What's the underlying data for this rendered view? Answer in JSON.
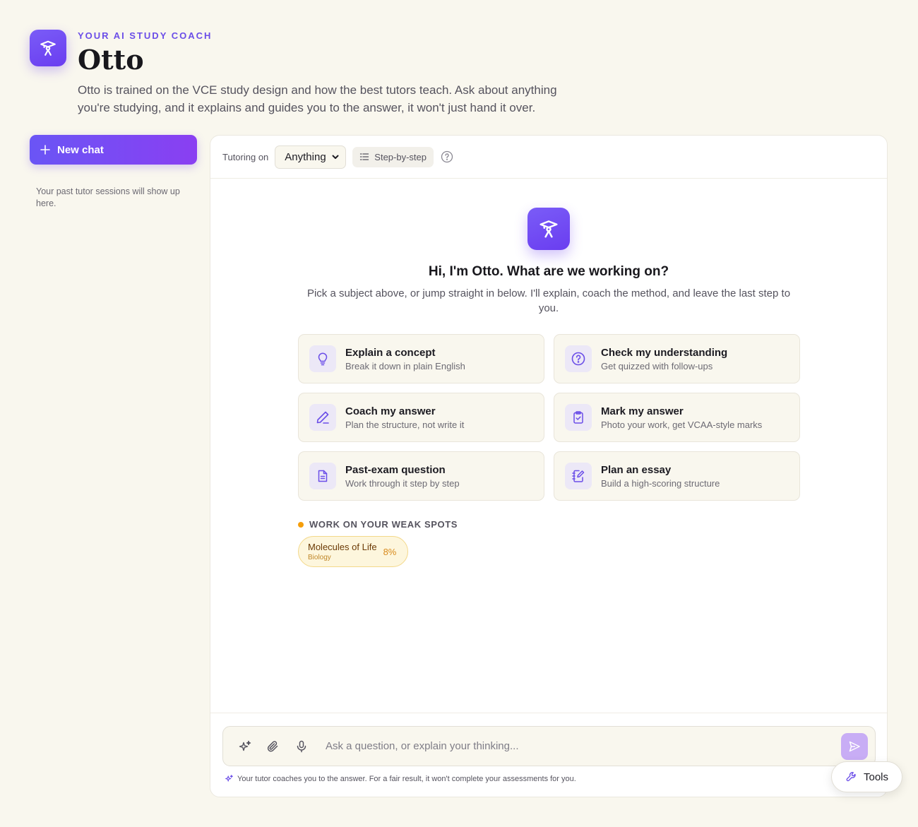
{
  "header": {
    "eyebrow": "YOUR AI STUDY COACH",
    "title": "Otto",
    "description": "Otto is trained on the VCE study design and how the best tutors teach. Ask about anything you're studying, and it explains and guides you to the answer, it won't just hand it over."
  },
  "sidebar": {
    "new_chat_label": "New chat",
    "empty_text": "Your past tutor sessions will show up here."
  },
  "toolbar": {
    "tutoring_label": "Tutoring on",
    "subject_selected": "Anything",
    "mode_label": "Step-by-step"
  },
  "welcome": {
    "title": "Hi, I'm Otto. What are we working on?",
    "subtitle": "Pick a subject above, or jump straight in below. I'll explain, coach the method, and leave the last step to you."
  },
  "cards": [
    {
      "title": "Explain a concept",
      "subtitle": "Break it down in plain English",
      "icon": "lightbulb-icon"
    },
    {
      "title": "Check my understanding",
      "subtitle": "Get quizzed with follow-ups",
      "icon": "question-circle-icon"
    },
    {
      "title": "Coach my answer",
      "subtitle": "Plan the structure, not write it",
      "icon": "pencil-icon"
    },
    {
      "title": "Mark my answer",
      "subtitle": "Photo your work, get VCAA-style marks",
      "icon": "clipboard-check-icon"
    },
    {
      "title": "Past-exam question",
      "subtitle": "Work through it step by step",
      "icon": "document-icon"
    },
    {
      "title": "Plan an essay",
      "subtitle": "Build a high-scoring structure",
      "icon": "notebook-pen-icon"
    }
  ],
  "weak_spots": {
    "label": "WORK ON YOUR WEAK SPOTS",
    "items": [
      {
        "title": "Molecules of Life",
        "subject": "Biology",
        "percent": "8%"
      }
    ]
  },
  "composer": {
    "placeholder": "Ask a question, or explain your thinking...",
    "disclaimer": "Your tutor coaches you to the answer. For a fair result, it won't complete your assessments for you."
  },
  "tools_label": "Tools",
  "colors": {
    "accent": "#6a3df0",
    "background": "#f9f7ee",
    "weak_spot": "#f59e0b"
  }
}
